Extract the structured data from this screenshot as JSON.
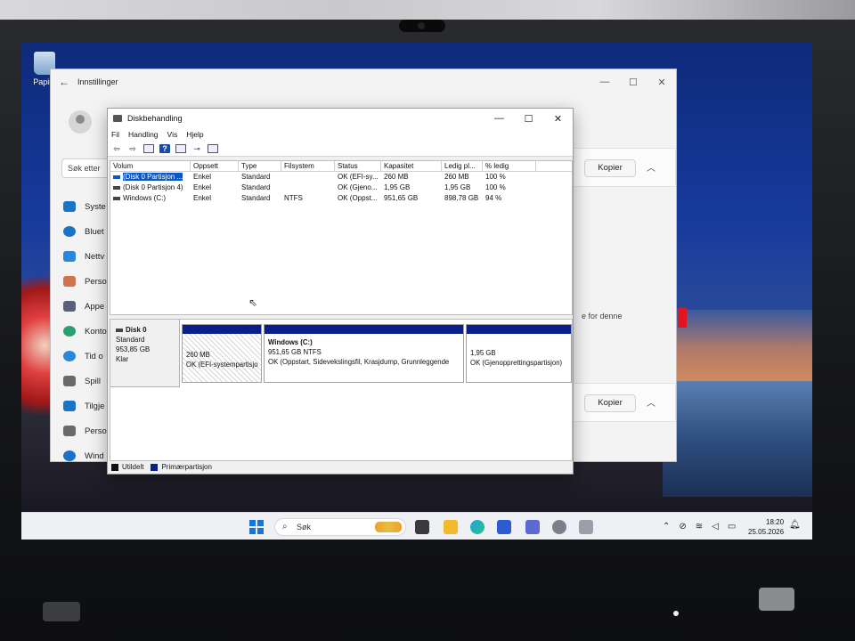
{
  "desktop": {
    "recycle_bin_label": "Papirk"
  },
  "settings": {
    "title": "Innstillinger",
    "search_placeholder": "Søk etter",
    "nav": [
      {
        "label": "Syste",
        "color": "#1a73c8"
      },
      {
        "label": "Bluet",
        "color": "#1a73c8"
      },
      {
        "label": "Nettv",
        "color": "#2a86d6"
      },
      {
        "label": "Perso",
        "color": "#d0734a"
      },
      {
        "label": "Appe",
        "color": "#5a5f7a"
      },
      {
        "label": "Konto",
        "color": "#2aa070"
      },
      {
        "label": "Tid o",
        "color": "#2a86d6"
      },
      {
        "label": "Spill",
        "color": "#6a6a6a"
      },
      {
        "label": "Tilgje",
        "color": "#1a73c8"
      },
      {
        "label": "Perso",
        "color": "#6a6a6a"
      },
      {
        "label": "Wind",
        "color": "#1a73c8"
      }
    ],
    "copy_button_1": "Kopier",
    "copy_button_2": "Kopier",
    "side_text": "e for denne"
  },
  "disk_mgmt": {
    "title": "Diskbehandling",
    "menu": [
      "Fil",
      "Handling",
      "Vis",
      "Hjelp"
    ],
    "columns": [
      "Volum",
      "Oppsett",
      "Type",
      "Filsystem",
      "Status",
      "Kapasitet",
      "Ledig pl...",
      "% ledig"
    ],
    "rows": [
      {
        "volum": "(Disk 0 Partisjon ...",
        "oppsett": "Enkel",
        "type": "Standard",
        "filsystem": "",
        "status": "OK (EFI-sy...",
        "kapasitet": "260 MB",
        "ledig": "260 MB",
        "pct": "100 %"
      },
      {
        "volum": "(Disk 0 Partisjon 4)",
        "oppsett": "Enkel",
        "type": "Standard",
        "filsystem": "",
        "status": "OK (Gjeno...",
        "kapasitet": "1,95 GB",
        "ledig": "1,95 GB",
        "pct": "100 %"
      },
      {
        "volum": "Windows (C:)",
        "oppsett": "Enkel",
        "type": "Standard",
        "filsystem": "NTFS",
        "status": "OK (Oppst...",
        "kapasitet": "951,65 GB",
        "ledig": "898,78 GB",
        "pct": "94 %"
      }
    ],
    "disk": {
      "name": "Disk 0",
      "type": "Standard",
      "size": "953,85 GB",
      "state": "Klar"
    },
    "partitions": [
      {
        "title": "",
        "size": "260 MB",
        "status": "OK (EFI-systempartisjo"
      },
      {
        "title": "Windows  (C:)",
        "size": "951,65 GB NTFS",
        "status": "OK (Oppstart, Sidevekslingsfil, Krasjdump, Grunnleggende"
      },
      {
        "title": "",
        "size": "1,95 GB",
        "status": "OK (Gjenopprettingspartisjon)"
      }
    ],
    "legend": {
      "unallocated": "Utildelt",
      "primary": "Primærpartisjon"
    },
    "colors": {
      "partition_band": "#0b1f8a",
      "unallocated": "#111111",
      "selection": "#0a57c8"
    }
  },
  "taskbar": {
    "search_placeholder": "Søk",
    "time": "18:20",
    "date": "25.05.2026"
  }
}
